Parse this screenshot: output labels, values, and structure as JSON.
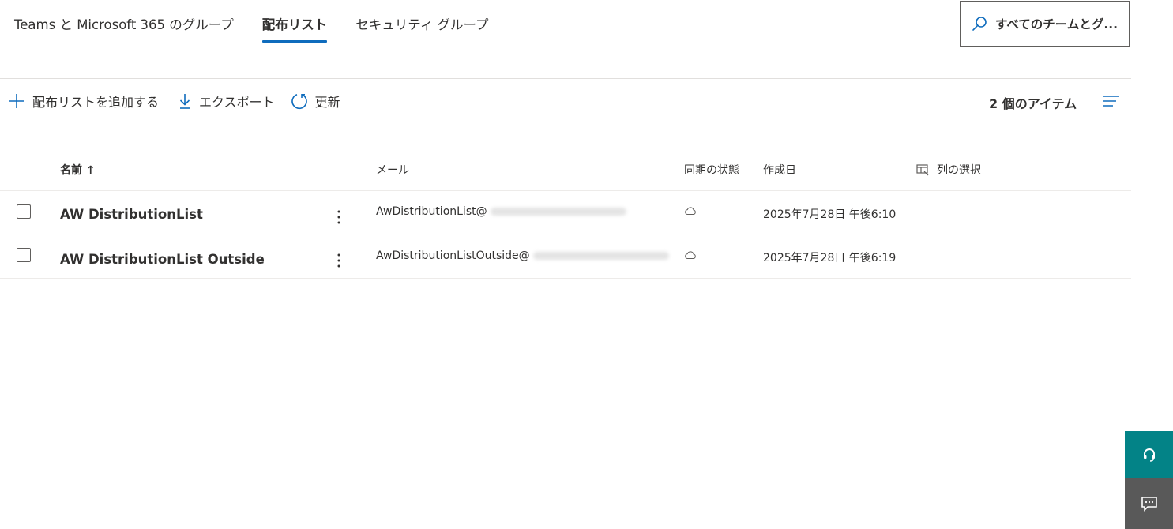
{
  "tabs": [
    {
      "label": "Teams と Microsoft 365 のグループ",
      "active": false
    },
    {
      "label": "配布リスト",
      "active": true
    },
    {
      "label": "セキュリティ グループ",
      "active": false
    }
  ],
  "search": {
    "value": "すべてのチームとグループを検索",
    "display": "すべてのチームとグ..."
  },
  "toolbar": {
    "add_label": "配布リストを追加する",
    "export_label": "エクスポート",
    "refresh_label": "更新"
  },
  "item_count": "2 個のアイテム",
  "columns": {
    "name": "名前 ↑",
    "email": "メール",
    "sync": "同期の状態",
    "created": "作成日",
    "choose_columns": "列の選択"
  },
  "rows": [
    {
      "name": "AW DistributionList",
      "email_prefix": "AwDistributionList@",
      "created": "2025年7月28日 午後6:10",
      "sync_icon": "cloud-icon"
    },
    {
      "name": "AW DistributionList Outside",
      "email_prefix": "AwDistributionListOutside@",
      "created": "2025年7月28日 午後6:19",
      "sync_icon": "cloud-icon"
    }
  ],
  "colors": {
    "accent": "#0f6cbd",
    "help_button": "#038387",
    "feedback_button": "#595959"
  }
}
